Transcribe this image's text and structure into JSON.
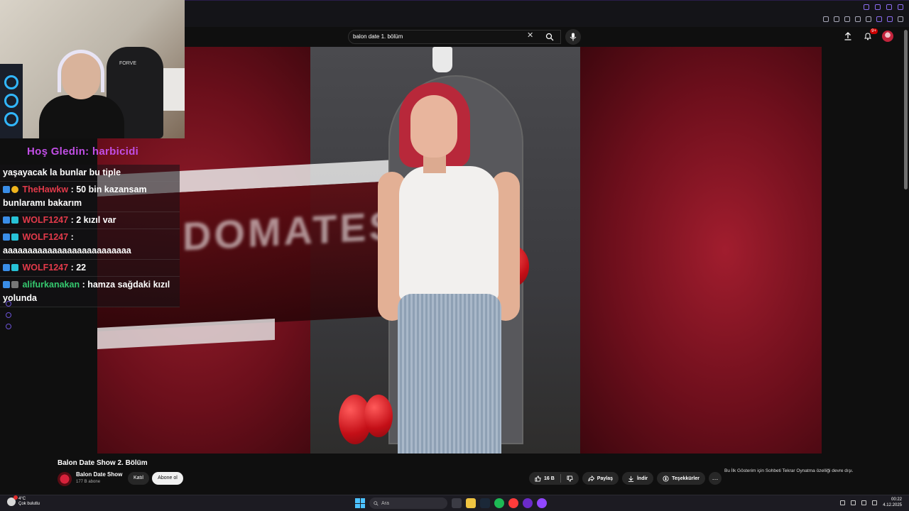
{
  "search": {
    "query": "balon date 1. bölüm",
    "clear_icon": "close-icon",
    "search_icon": "search-icon",
    "mic_icon": "mic-icon"
  },
  "header": {
    "notification_count": "9+",
    "upload_icon": "upload-icon",
    "bell_icon": "bell-icon"
  },
  "webcam": {
    "chair_brand": "FORVE"
  },
  "video": {
    "blurred_text": "DOMATES"
  },
  "chat": {
    "welcome": "Hoş Gledin: harbicidi",
    "messages": [
      {
        "user": "",
        "text": "yaşayacak la bunlar bu tiple"
      },
      {
        "user": "TheHawkw",
        "text": ": 50 bin kazansam bunlaramı bakarım"
      },
      {
        "user": "WOLF1247",
        "text": ": 2 kızıl var"
      },
      {
        "user": "WOLF1247",
        "text": ": aaaaaaaaaaaaaaaaaaaaaaaaaa"
      },
      {
        "user": "WOLF1247",
        "text": ": 22"
      },
      {
        "user": "alifurkanakan",
        "text": ": hamza sağdaki kızıl yolunda"
      }
    ]
  },
  "video_info": {
    "title": "Balon Date Show 2. Bölüm",
    "channel": "Balon Date Show",
    "subscribers": "177 B abone",
    "join_label": "Katıl",
    "subscribe_label": "Abone ol",
    "like_count": "16 B",
    "share_label": "Paylaş",
    "download_label": "İndir",
    "thanks_label": "Teşekkürler",
    "more_label": "…",
    "side_note": "Bu İlk Gösterim için Sohbeti Tekrar Oynatma özelliği devre dışı."
  },
  "taskbar": {
    "weather_temp": "4°C",
    "weather_desc": "Çok bulutlu",
    "search_placeholder": "Ara",
    "time": "00:22",
    "date": "4.12.2025"
  },
  "colors": {
    "youtube_bg": "#0f0f0f",
    "chat_welcome": "#c14ee5",
    "chat_user": "#e23a4a",
    "video_red": "#8a1422"
  }
}
